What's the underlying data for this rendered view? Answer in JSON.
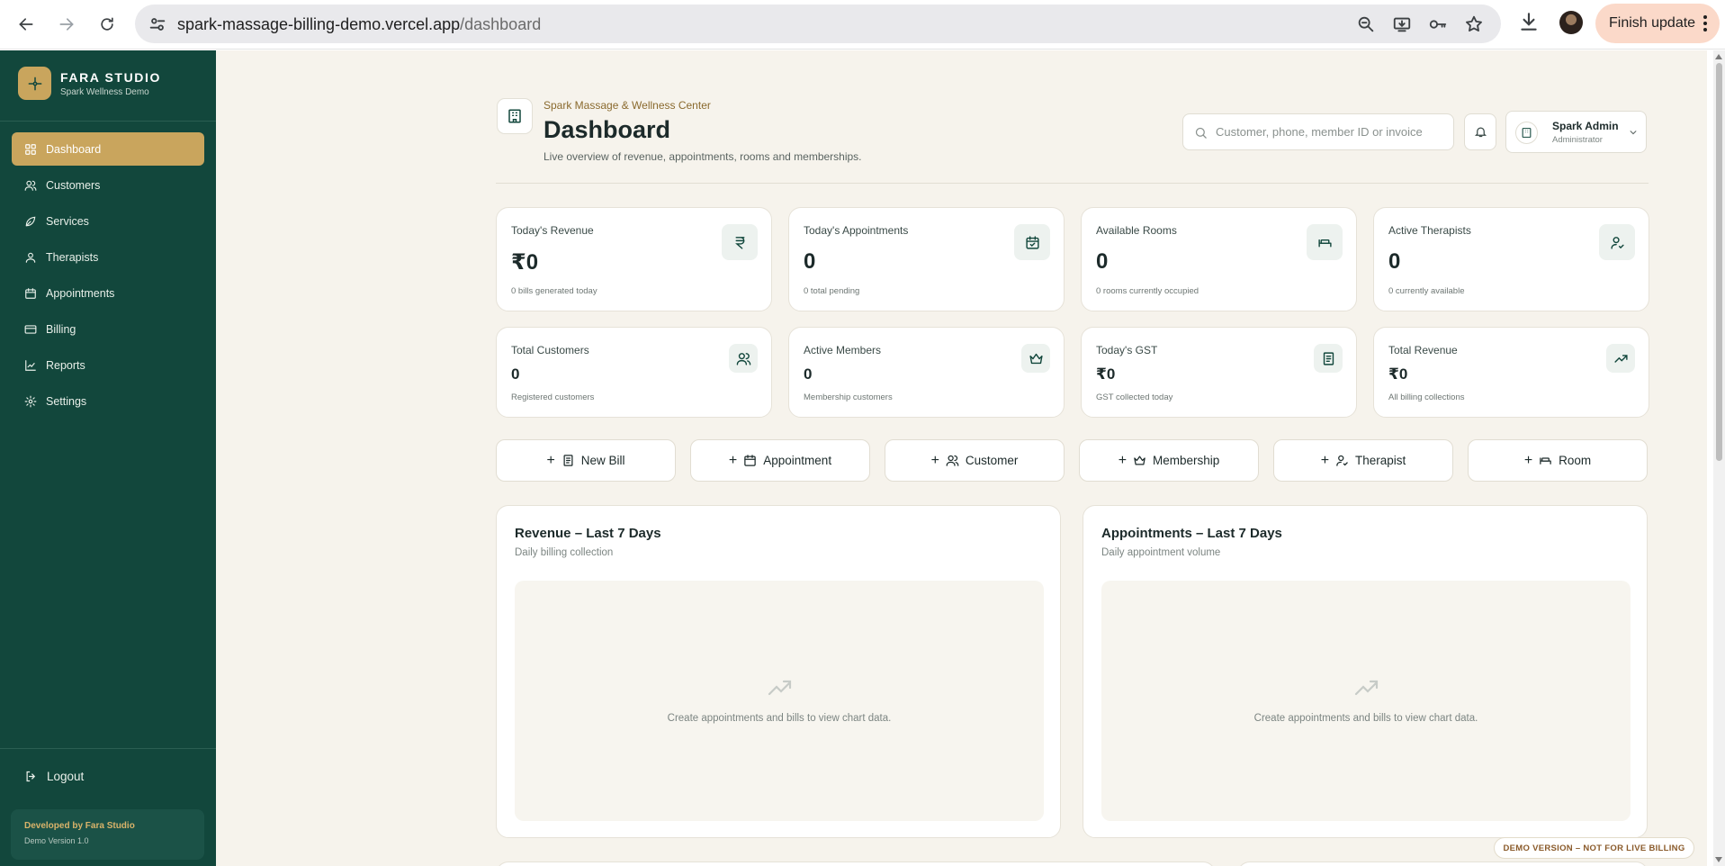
{
  "browser": {
    "url_host": "spark-massage-billing-demo.vercel.app",
    "url_path": "/dashboard",
    "finish_update_label": "Finish update"
  },
  "sidebar": {
    "brand_name": "FARA STUDIO",
    "brand_sub": "Spark Wellness Demo",
    "items": [
      {
        "label": "Dashboard",
        "icon": "grid-icon",
        "active": true
      },
      {
        "label": "Customers",
        "icon": "users-icon"
      },
      {
        "label": "Services",
        "icon": "leaf-icon"
      },
      {
        "label": "Therapists",
        "icon": "user-icon"
      },
      {
        "label": "Appointments",
        "icon": "calendar-icon"
      },
      {
        "label": "Billing",
        "icon": "card-icon"
      },
      {
        "label": "Reports",
        "icon": "chart-icon"
      },
      {
        "label": "Settings",
        "icon": "gear-icon"
      }
    ],
    "logout_label": "Logout",
    "developer": "Developed by Fara Studio",
    "version": "Demo Version 1.0"
  },
  "header": {
    "org_name": "Spark Massage & Wellness Center",
    "title": "Dashboard",
    "subtitle": "Live overview of revenue, appointments, rooms and memberships.",
    "search_placeholder": "Customer, phone, member ID or invoice",
    "user_name": "Spark Admin",
    "user_role": "Administrator"
  },
  "stats_row1": [
    {
      "label": "Today's Revenue",
      "value": "₹0",
      "sub": "0 bills generated today",
      "icon": "rupee-icon"
    },
    {
      "label": "Today's Appointments",
      "value": "0",
      "sub": "0 total pending",
      "icon": "calendar-check-icon"
    },
    {
      "label": "Available Rooms",
      "value": "0",
      "sub": "0 rooms currently occupied",
      "icon": "bed-icon"
    },
    {
      "label": "Active Therapists",
      "value": "0",
      "sub": "0 currently available",
      "icon": "user-check-icon"
    }
  ],
  "stats_row2": [
    {
      "label": "Total Customers",
      "value": "0",
      "sub": "Registered customers",
      "icon": "users-icon"
    },
    {
      "label": "Active Members",
      "value": "0",
      "sub": "Membership customers",
      "icon": "crown-icon"
    },
    {
      "label": "Today's GST",
      "value": "₹0",
      "sub": "GST collected today",
      "icon": "receipt-icon"
    },
    {
      "label": "Total Revenue",
      "value": "₹0",
      "sub": "All billing collections",
      "icon": "trending-up-icon"
    }
  ],
  "quick_actions": [
    {
      "label": "New Bill",
      "icon": "receipt-icon"
    },
    {
      "label": "Appointment",
      "icon": "calendar-icon"
    },
    {
      "label": "Customer",
      "icon": "users-icon"
    },
    {
      "label": "Membership",
      "icon": "crown-icon"
    },
    {
      "label": "Therapist",
      "icon": "user-check-icon"
    },
    {
      "label": "Room",
      "icon": "bed-icon"
    }
  ],
  "charts": [
    {
      "title": "Revenue – Last 7 Days",
      "subtitle": "Daily billing collection",
      "empty_text": "Create appointments and bills to view chart data."
    },
    {
      "title": "Appointments – Last 7 Days",
      "subtitle": "Daily appointment volume",
      "empty_text": "Create appointments and bills to view chart data."
    }
  ],
  "demo_badge": "DEMO VERSION – NOT FOR LIVE BILLING",
  "colors": {
    "sidebar_bg": "#12473c",
    "accent_gold": "#c9a55d",
    "page_bg": "#f6f3ec"
  }
}
